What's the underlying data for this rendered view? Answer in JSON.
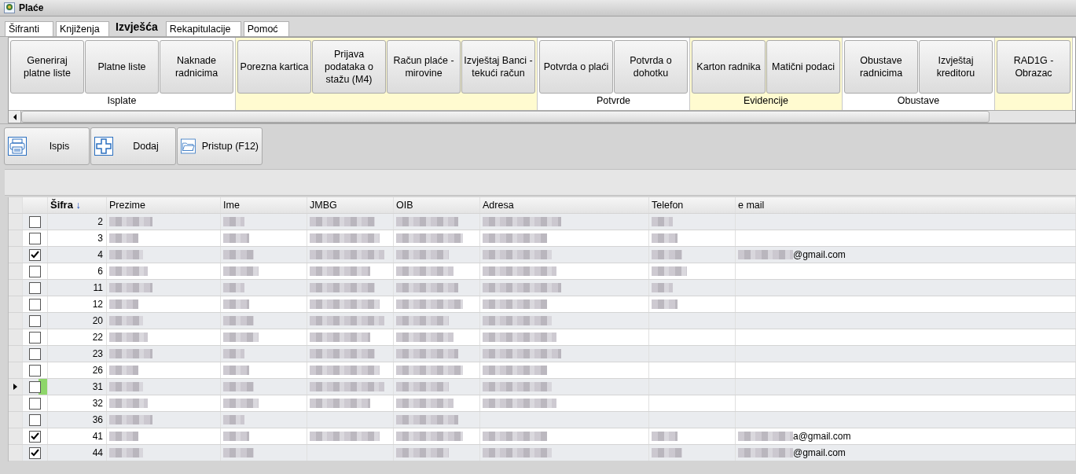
{
  "window": {
    "title": "Plaće"
  },
  "tabs": [
    {
      "label": "Šifranti",
      "selected": false
    },
    {
      "label": "Knjiženja",
      "selected": false
    },
    {
      "label": "Izvješća",
      "selected": true
    },
    {
      "label": "Rekapitulacije",
      "selected": false
    },
    {
      "label": "Pomoć",
      "selected": false
    }
  ],
  "ribbon": {
    "groups": [
      {
        "label": "Isplate",
        "highlighted": false,
        "buttons": [
          "Generiraj platne liste",
          "Platne liste",
          "Naknade radnicima"
        ]
      },
      {
        "highlighted": true,
        "buttons": [
          "Porezna kartica",
          "Prijava podataka o stažu (M4)",
          "Račun plaće - mirovine",
          "Izvještaj Banci - tekući račun"
        ]
      },
      {
        "label": "Potvrde",
        "highlighted": false,
        "buttons": [
          "Potvrda o plaći",
          "Potvrda o dohotku"
        ]
      },
      {
        "label": "Evidencije",
        "highlighted": true,
        "buttons": [
          "Karton radnika",
          "Matični podaci"
        ]
      },
      {
        "label": "Obustave",
        "highlighted": false,
        "buttons": [
          "Obustave radnicima",
          "Izvještaj kreditoru"
        ]
      },
      {
        "highlighted": true,
        "buttons": [
          "RAD1G - Obrazac"
        ]
      }
    ]
  },
  "toolbar": [
    {
      "label": "Ispis",
      "kind": "printer"
    },
    {
      "label": "Dodaj",
      "kind": "add"
    },
    {
      "label": "Pristup (F12)",
      "kind": "folder"
    }
  ],
  "table": {
    "columns": [
      {
        "label": "Šifra",
        "sorted": true,
        "sort_arrow": "↓"
      },
      {
        "label": "Prezime",
        "sorted": false
      },
      {
        "label": "Ime",
        "sorted": false
      },
      {
        "label": "JMBG",
        "sorted": false
      },
      {
        "label": "OIB",
        "sorted": false
      },
      {
        "label": "Adresa",
        "sorted": false
      },
      {
        "label": "Telefon",
        "sorted": false
      },
      {
        "label": "e mail",
        "sorted": false
      }
    ],
    "rows": [
      {
        "sifra": "2",
        "checked": false,
        "current": false,
        "redacted": [
          true,
          true,
          true,
          true,
          true,
          true
        ]
      },
      {
        "sifra": "3",
        "checked": false,
        "current": false,
        "redacted": [
          true,
          true,
          true,
          true,
          true,
          true
        ]
      },
      {
        "sifra": "4",
        "checked": true,
        "current": false,
        "redacted": [
          true,
          true,
          true,
          true,
          true,
          true
        ],
        "email_redacted": true,
        "email": "@gmail.com"
      },
      {
        "sifra": "6",
        "checked": false,
        "current": false,
        "redacted": [
          true,
          true,
          true,
          true,
          true,
          true
        ]
      },
      {
        "sifra": "11",
        "checked": false,
        "current": false,
        "redacted": [
          true,
          true,
          true,
          true,
          true,
          true
        ]
      },
      {
        "sifra": "12",
        "checked": false,
        "current": false,
        "redacted": [
          true,
          true,
          true,
          true,
          true,
          true
        ]
      },
      {
        "sifra": "20",
        "checked": false,
        "current": false,
        "redacted": [
          true,
          true,
          true,
          true,
          true,
          false
        ]
      },
      {
        "sifra": "22",
        "checked": false,
        "current": false,
        "redacted": [
          true,
          true,
          true,
          true,
          true,
          false
        ]
      },
      {
        "sifra": "23",
        "checked": false,
        "current": false,
        "redacted": [
          true,
          true,
          true,
          true,
          true,
          false
        ]
      },
      {
        "sifra": "26",
        "checked": false,
        "current": false,
        "redacted": [
          true,
          true,
          true,
          true,
          true,
          false
        ]
      },
      {
        "sifra": "31",
        "checked": false,
        "current": true,
        "redacted": [
          true,
          true,
          true,
          true,
          true,
          false
        ]
      },
      {
        "sifra": "32",
        "checked": false,
        "current": false,
        "redacted": [
          true,
          true,
          true,
          true,
          true,
          false
        ]
      },
      {
        "sifra": "36",
        "checked": false,
        "current": false,
        "redacted": [
          true,
          true,
          false,
          true,
          false,
          false
        ]
      },
      {
        "sifra": "41",
        "checked": true,
        "current": false,
        "redacted": [
          true,
          true,
          true,
          true,
          true,
          true
        ],
        "email_redacted": true,
        "email": "a@gmail.com"
      },
      {
        "sifra": "44",
        "checked": true,
        "current": false,
        "redacted": [
          true,
          true,
          false,
          true,
          true,
          true
        ],
        "email_redacted": true,
        "email": "@gmail.com"
      }
    ]
  }
}
